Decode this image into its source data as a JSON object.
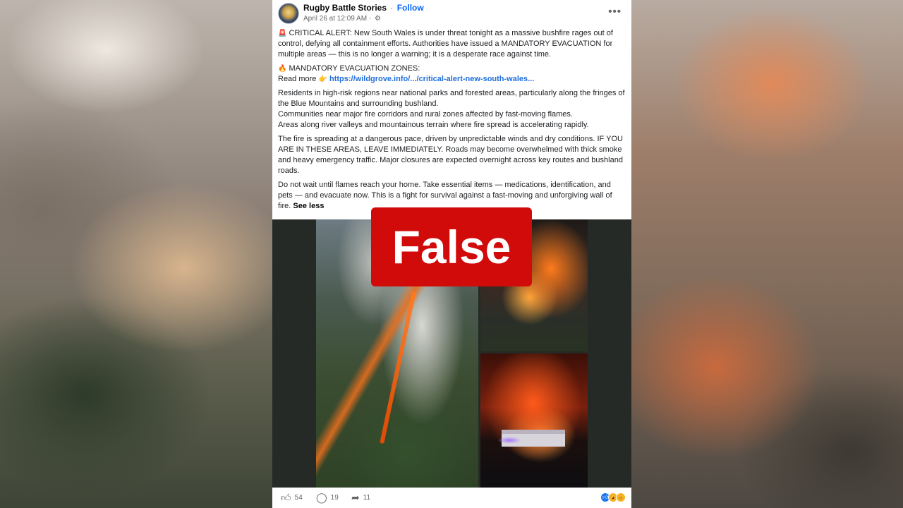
{
  "post": {
    "page_name": "Rugby Battle Stories",
    "separator": "·",
    "follow_label": "Follow",
    "timestamp": "April 26 at 12:09 AM",
    "meta_separator": "·",
    "privacy_icon": "gear-icon",
    "more_label": "•••",
    "paragraphs": {
      "p1_icon": "🚨",
      "p1": "CRITICAL ALERT: New South Wales is under threat tonight as a massive bushfire rages out of control, defying all containment efforts. Authorities have issued a MANDATORY EVACUATION for multiple areas — this is no longer a warning; it is a desperate race against time.",
      "p2_icon": "🔥",
      "p2_line1": "MANDATORY EVACUATION ZONES:",
      "p2_readmore": "Read more",
      "p2_hand": "👉",
      "p2_link": "https://wildgrove.info/.../critical-alert-new-south-wales...",
      "p3_line1": "Residents in high-risk regions near national parks and forested areas, particularly along the fringes of the Blue Mountains and surrounding bushland.",
      "p3_line2": "Communities near major fire corridors and rural zones affected by fast-moving flames.",
      "p3_line3": "Areas along river valleys and mountainous terrain where fire spread is accelerating rapidly.",
      "p4": "The fire is spreading at a dangerous pace, driven by unpredictable winds and dry conditions. IF YOU ARE IN THESE AREAS, LEAVE IMMEDIATELY. Roads may become overwhelmed with thick smoke and heavy emergency traffic. Major closures are expected overnight across key routes and bushland roads.",
      "p5": "Do not wait until flames reach your home. Take essential items — medications, identification, and pets — and evacuate now. This is a fight for survival against a fast-moving and unforgiving wall of fire.",
      "see_less": "See less"
    },
    "badge_label": "False",
    "actions": {
      "likes": "54",
      "comments": "19",
      "shares": "11"
    },
    "icons": {
      "like": "thumbs-up-icon",
      "comment": "comment-icon",
      "share": "share-icon"
    },
    "colors": {
      "follow": "#0866ff",
      "link": "#216fdb",
      "badge": "#d10a0a"
    }
  }
}
